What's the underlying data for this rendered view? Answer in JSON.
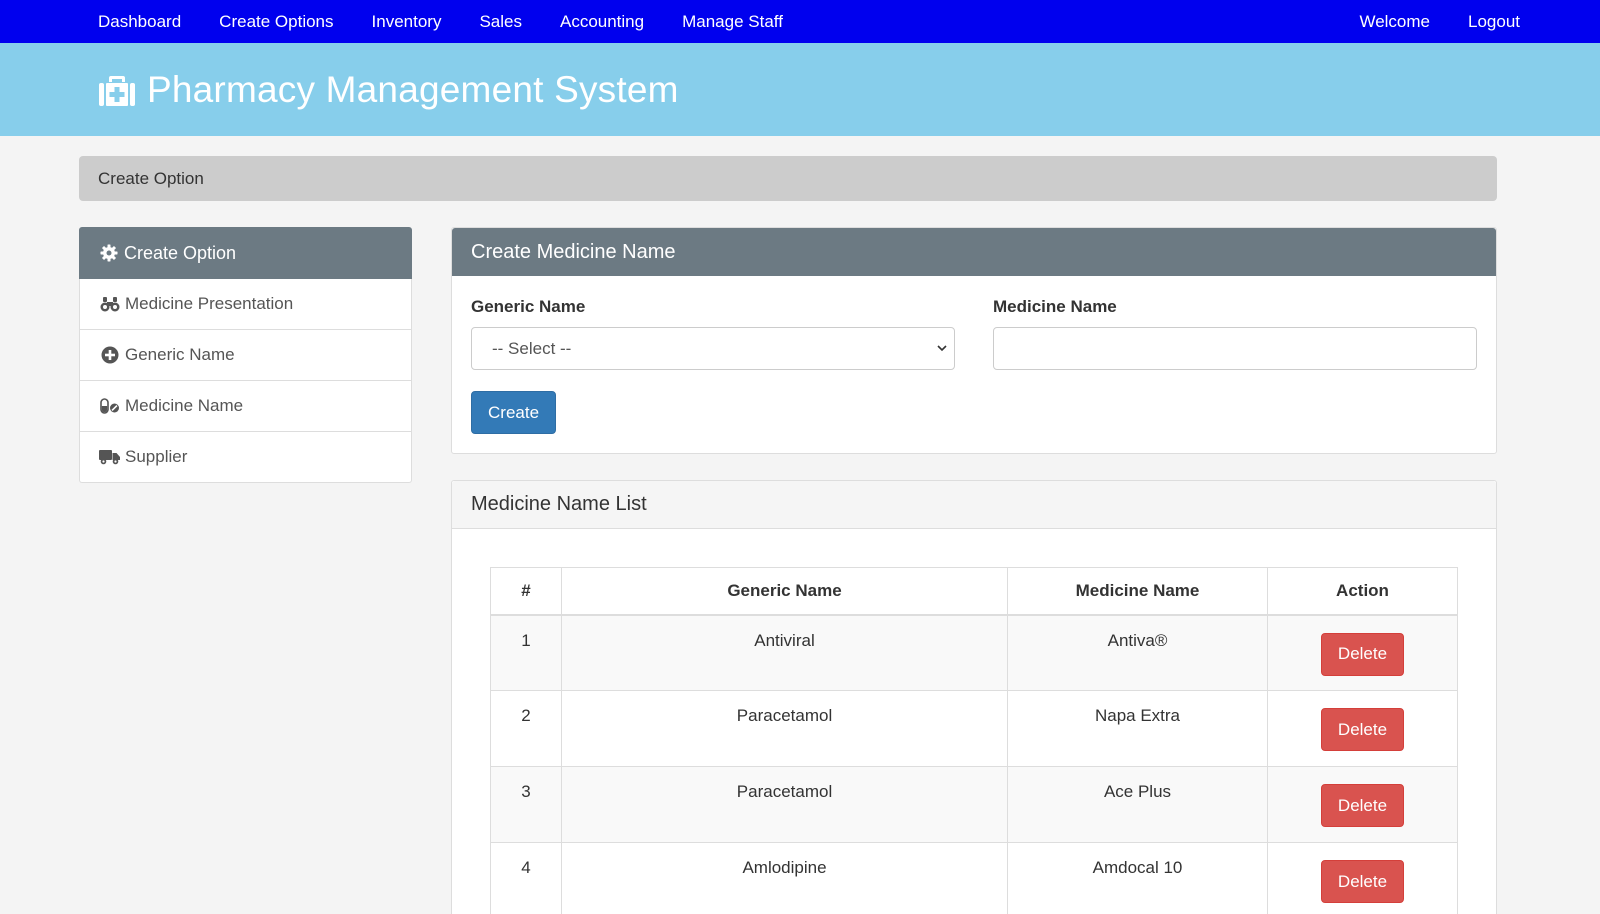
{
  "topnav": {
    "left": [
      "Dashboard",
      "Create Options",
      "Inventory",
      "Sales",
      "Accounting",
      "Manage Staff"
    ],
    "right": [
      "Welcome",
      "Logout"
    ]
  },
  "banner": {
    "icon": "medkit-icon",
    "title": "Pharmacy Management System"
  },
  "breadcrumb": "Create Option",
  "sidebar": {
    "header": "Create Option",
    "header_icon": "gear-icon",
    "items": [
      {
        "label": "Medicine Presentation",
        "icon": "binoculars-icon"
      },
      {
        "label": "Generic Name",
        "icon": "plus-circle-icon"
      },
      {
        "label": "Medicine Name",
        "icon": "pills-icon"
      },
      {
        "label": "Supplier",
        "icon": "truck-icon"
      }
    ]
  },
  "form": {
    "title": "Create Medicine Name",
    "generic_label": "Generic Name",
    "generic_selected": "-- Select --",
    "medicine_label": "Medicine Name",
    "medicine_value": "",
    "create_label": "Create"
  },
  "list": {
    "title": "Medicine Name List",
    "columns": [
      "#",
      "Generic Name",
      "Medicine Name",
      "Action"
    ],
    "rows": [
      {
        "num": "1",
        "generic": "Antiviral",
        "medicine": "Antiva®",
        "action": "Delete"
      },
      {
        "num": "2",
        "generic": "Paracetamol",
        "medicine": "Napa Extra",
        "action": "Delete"
      },
      {
        "num": "3",
        "generic": "Paracetamol",
        "medicine": "Ace Plus",
        "action": "Delete"
      },
      {
        "num": "4",
        "generic": "Amlodipine",
        "medicine": "Amdocal 10",
        "action": "Delete"
      }
    ]
  },
  "colors": {
    "nav": "#0000ee",
    "banner": "#87ceeb",
    "panel_head": "#6c7a83",
    "primary": "#337ab7",
    "danger": "#d9534f"
  }
}
